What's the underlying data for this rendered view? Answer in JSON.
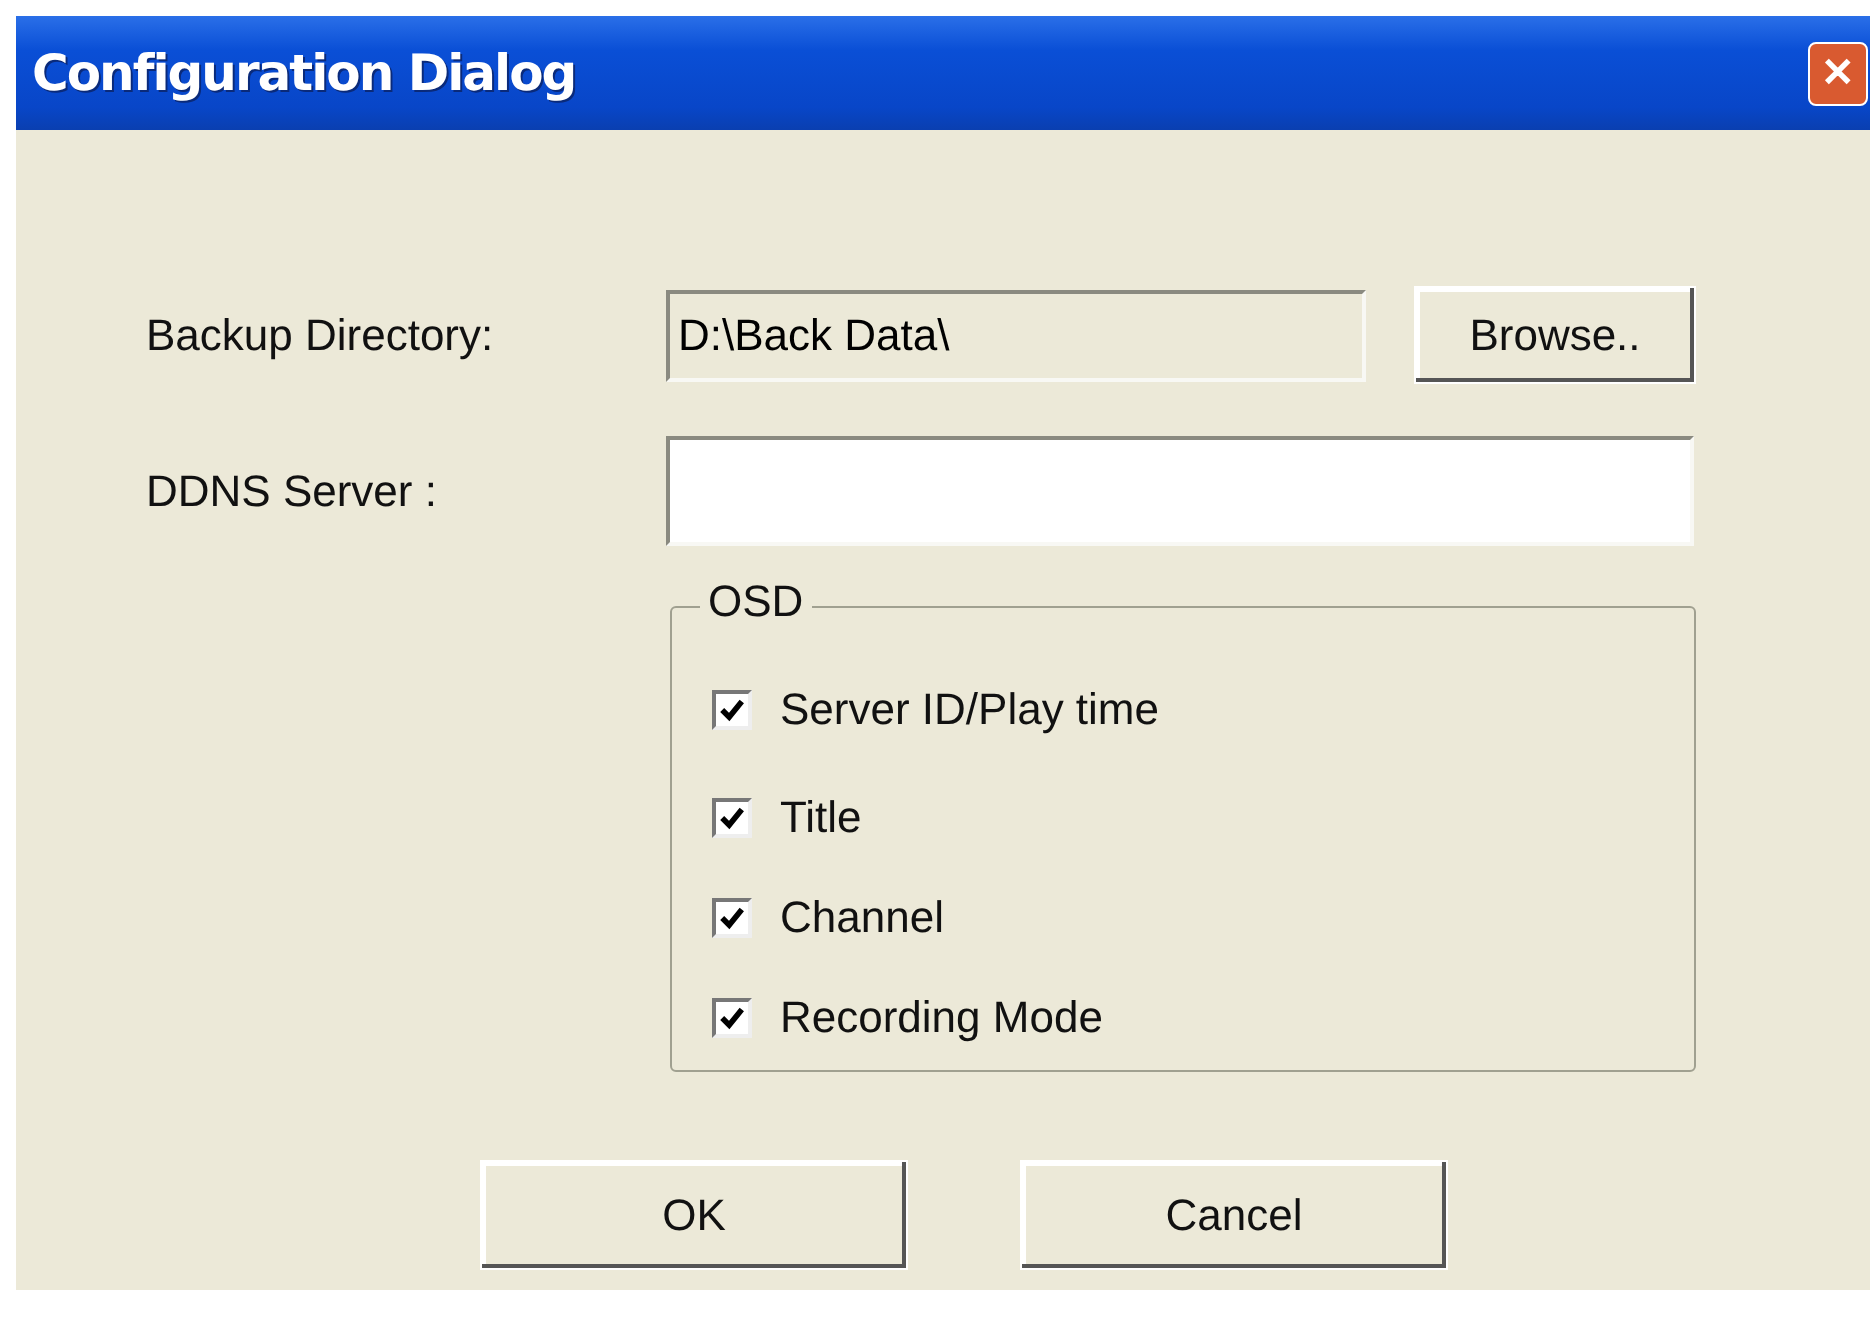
{
  "window": {
    "title": "Configuration Dialog",
    "close": "✕"
  },
  "backup": {
    "label": "Backup Directory:",
    "value": "D:\\Back Data\\",
    "disabled": true,
    "button": "Browse.."
  },
  "ddns": {
    "label": "DDNS Server :"
  },
  "osd": {
    "title": "OSD",
    "options": [
      {
        "label": "Server ID/Play time",
        "checked": true
      },
      {
        "label": "Title",
        "checked": true
      },
      {
        "label": "Channel",
        "checked": true
      },
      {
        "label": "Recording Mode",
        "checked": true
      }
    ]
  },
  "buttons": [
    "OK",
    "Cancel"
  ]
}
